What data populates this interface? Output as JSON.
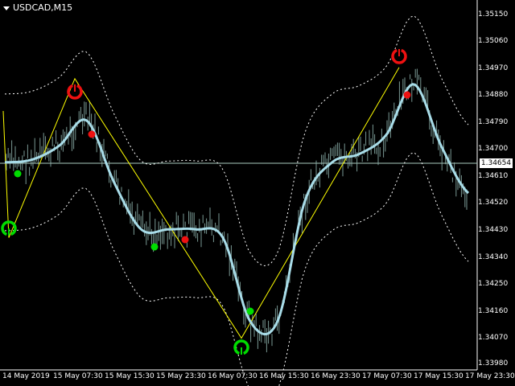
{
  "window": {
    "title": "USDCAD,M15",
    "menu_icon": "triangle-down-icon"
  },
  "price_axis": {
    "labels": [
      "1.35150",
      "1.35060",
      "1.34970",
      "1.34880",
      "1.34790",
      "1.34700",
      "1.34610",
      "1.34520",
      "1.34430",
      "1.34340",
      "1.34250",
      "1.34160",
      "1.34070",
      "1.33980"
    ],
    "current_price": "1.34654"
  },
  "time_axis": {
    "labels": [
      "14 May 2019",
      "15 May 07:30",
      "15 May 15:30",
      "15 May 23:30",
      "16 May 07:30",
      "16 May 15:30",
      "16 May 23:30",
      "17 May 07:30",
      "17 May 15:30",
      "17 May 23:30"
    ]
  },
  "colors": {
    "background": "#000000",
    "grid_line": "#aaccc0",
    "candles": "#8fb3ad",
    "ma_line": "#a8dce8",
    "bands": "#ffffff",
    "zigzag": "#ffff00",
    "buy_marker": "#00dd00",
    "sell_marker": "#ee1111"
  },
  "chart_data": {
    "type": "line",
    "symbol": "USDCAD",
    "timeframe": "M15",
    "ylim": [
      1.3394,
      1.3519
    ],
    "x": [
      "14 May 2019",
      "15 May 07:30",
      "15 May 15:30",
      "15 May 23:30",
      "16 May 07:30",
      "16 May 15:30",
      "16 May 23:30",
      "17 May 07:30",
      "17 May 15:30",
      "17 May 23:30"
    ],
    "series": [
      {
        "values": [
          1.3462,
          1.3463,
          1.3468,
          1.3477,
          1.3455,
          1.3438,
          1.3438,
          1.3438,
          1.3435,
          1.3405,
          1.3405,
          1.3448,
          1.3462,
          1.3465,
          1.3472,
          1.349,
          1.3468,
          1.3451
        ]
      }
    ],
    "zigzag_points": [
      1.3435,
      1.3492,
      1.3399,
      1.3496
    ],
    "current_price": 1.34654
  }
}
